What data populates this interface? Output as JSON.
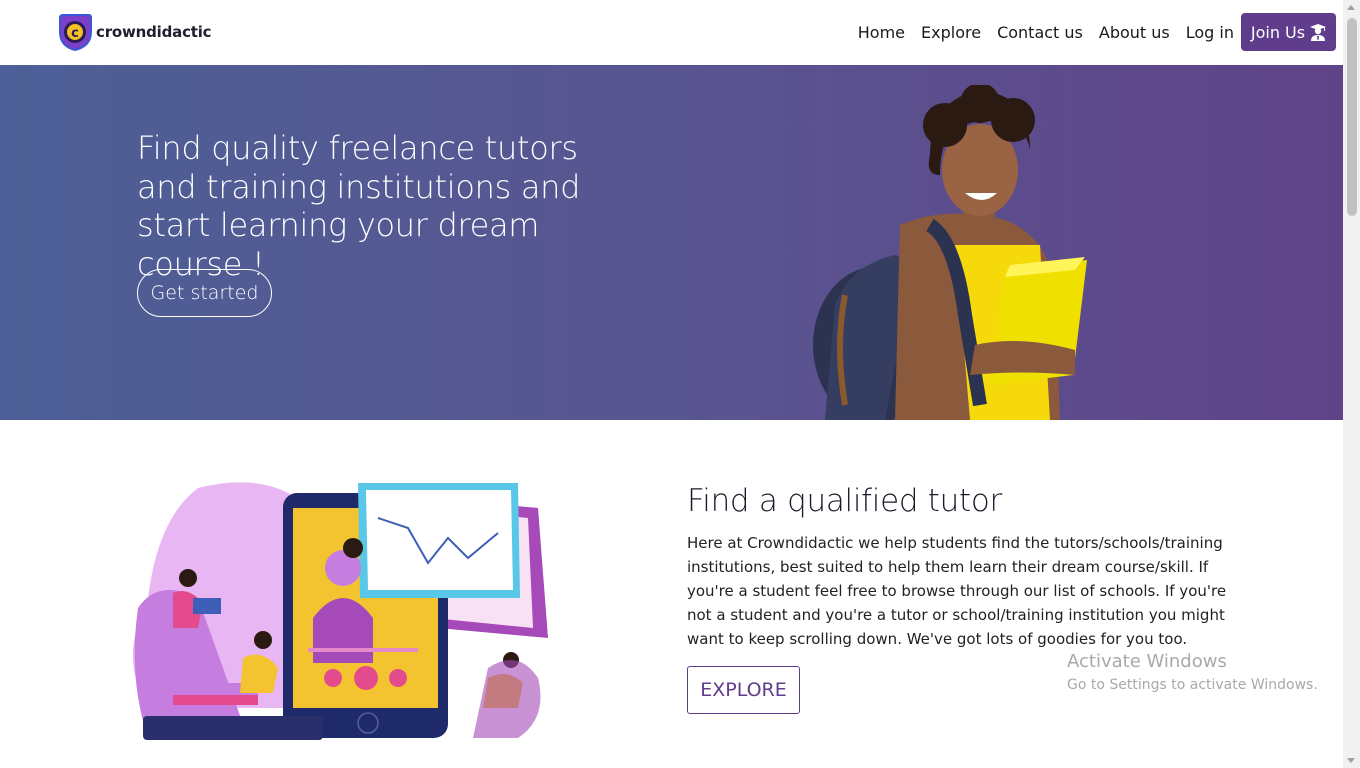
{
  "brand": {
    "name": "crowndidactic",
    "logo_letter": "c"
  },
  "nav": {
    "items": [
      {
        "label": "Home"
      },
      {
        "label": "Explore"
      },
      {
        "label": "Contact us"
      },
      {
        "label": "About us"
      },
      {
        "label": "Log in"
      }
    ],
    "join_label": "Join Us",
    "join_icon": "graduate-icon"
  },
  "hero": {
    "title": "Find quality freelance tutors and training institutions and start learning your dream course !",
    "cta_label": "Get started"
  },
  "section": {
    "title": "Find a qualified tutor",
    "text": "Here at Crowndidactic we help students find the tutors/schools/training institutions, best suited to help them learn their dream course/skill. If you're a student feel free to browse through our list of schools. If you're not a student and you're a tutor or school/training institution you might want to keep scrolling down. We've got lots of goodies for you too.",
    "cta_label": "EXPLORE"
  },
  "watermark": {
    "title": "Activate Windows",
    "subtitle": "Go to Settings to activate Windows."
  },
  "colors": {
    "brand_purple": "#5f3d8c",
    "hero_gradient_start": "#4d5f96",
    "hero_gradient_end": "#5f4389"
  }
}
